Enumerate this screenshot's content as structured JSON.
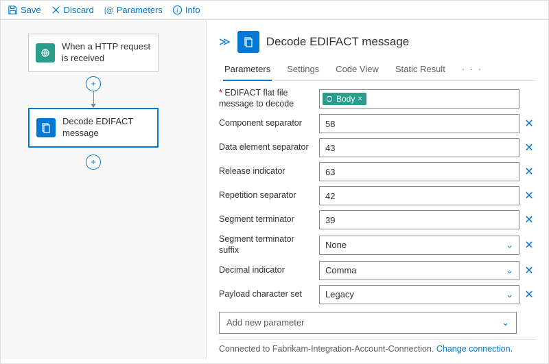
{
  "toolbar": {
    "save": "Save",
    "discard": "Discard",
    "parameters": "Parameters",
    "info": "Info"
  },
  "canvas": {
    "node1": "When a HTTP request is received",
    "node2": "Decode EDIFACT message"
  },
  "panel": {
    "title": "Decode EDIFACT message",
    "tabs": {
      "parameters": "Parameters",
      "settings": "Settings",
      "codeview": "Code View",
      "staticresult": "Static Result",
      "more": "· · ·"
    },
    "params": {
      "flatfile_label": "EDIFACT flat file message to decode",
      "flatfile_token": "Body",
      "component_sep_label": "Component separator",
      "component_sep_value": "58",
      "data_elem_sep_label": "Data element separator",
      "data_elem_sep_value": "43",
      "release_ind_label": "Release indicator",
      "release_ind_value": "63",
      "repetition_sep_label": "Repetition separator",
      "repetition_sep_value": "42",
      "segment_term_label": "Segment terminator",
      "segment_term_value": "39",
      "segment_term_suffix_label": "Segment terminator suffix",
      "segment_term_suffix_value": "None",
      "decimal_ind_label": "Decimal indicator",
      "decimal_ind_value": "Comma",
      "payload_charset_label": "Payload character set",
      "payload_charset_value": "Legacy",
      "add_param": "Add new parameter"
    },
    "footer": {
      "text": "Connected to Fabrikam-Integration-Account-Connection.",
      "link": "Change connection."
    }
  }
}
